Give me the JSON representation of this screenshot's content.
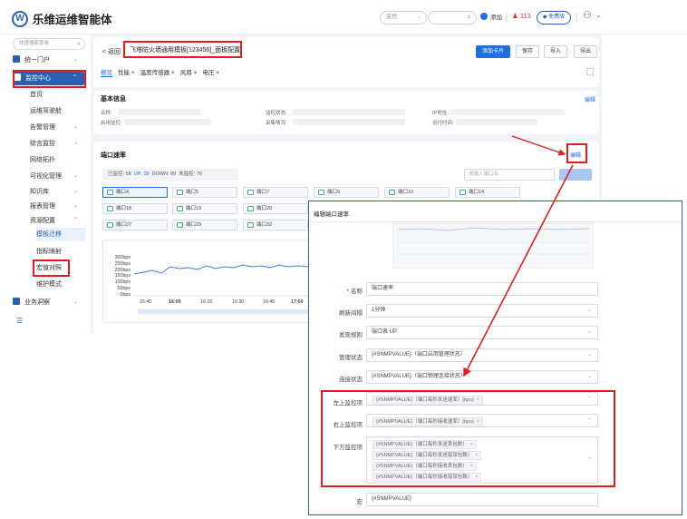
{
  "app": {
    "name": "乐维运维智能体",
    "logo_icon": "lewei-logo-icon"
  },
  "topbar": {
    "monitor_select": "监控",
    "add_label": "添加",
    "alarm_count": "113",
    "free_label": "免费版"
  },
  "sidebar": {
    "search_placeholder": "快速搜索菜单",
    "items": [
      {
        "label": "统一门户"
      },
      {
        "label": "监控中心"
      },
      {
        "label": "首页"
      },
      {
        "label": "运维驾驶舱"
      },
      {
        "label": "告警管理"
      },
      {
        "label": "综合监控"
      },
      {
        "label": "网络拓扑"
      },
      {
        "label": "可视化管理"
      },
      {
        "label": "知识库"
      },
      {
        "label": "报表管理"
      },
      {
        "label": "资源配置"
      },
      {
        "label": "模板迁移"
      },
      {
        "label": "指标映射"
      },
      {
        "label": "宏值对照"
      },
      {
        "label": "维护模式"
      },
      {
        "label": "业务洞察"
      }
    ]
  },
  "page": {
    "back_label": "< 返回",
    "title": "飞塔防火墙通用模板[123456]_面板配置",
    "buttons": {
      "add_card": "添加卡片",
      "save": "保存",
      "import": "导入",
      "export": "导出"
    },
    "tabs": [
      "概览",
      "性能 ×",
      "温度传感器 ×",
      "风扇 ×",
      "电压 ×"
    ]
  },
  "basic_info": {
    "title": "基本信息",
    "edit": "编辑",
    "fields": {
      "name": "名称:",
      "monitor_status": "监控状态:",
      "ip": "IP地址:",
      "enabled_monitor": "启用监控:",
      "collect_status": "采集情况:",
      "uptime": "运行时间:"
    }
  },
  "port_rate": {
    "title": "端口速率",
    "edit": "编辑",
    "stat_prefix": "已监控: 58",
    "stat_up": "UP: 39",
    "stat_down": "DOWN: 89",
    "stat_unmon": "未监控: 70",
    "search_placeholder": "请输入端口名",
    "ports": [
      "端口4",
      "端口5",
      "端口7",
      "端口9",
      "端口10",
      "端口14",
      "端口18",
      "端口19",
      "端口20",
      "端口27",
      "端口29",
      "端口32"
    ],
    "y_ticks": [
      "300bps",
      "250bps",
      "200bps",
      "150bps",
      "100bps",
      "50bps",
      "0bps"
    ],
    "x_ticks": [
      "15:45",
      "16:00",
      "16:15",
      "16:30",
      "16:45",
      "17:00"
    ]
  },
  "modal": {
    "title": "编辑端口速率",
    "fields": {
      "name_label": "名称",
      "name_value": "端口速率",
      "refresh_label": "刷新间隔",
      "refresh_value": "1分钟",
      "discover_label": "发现规则",
      "discover_value": "端口表 UP",
      "admin_label": "管理状态",
      "admin_value": "{#SNMPVALUE}（端口启用管理状态）",
      "link_label": "连接状态",
      "link_value": "{#SNMPVALUE}（端口物理连接状态）",
      "left_label": "左上监控项",
      "left_tag": "{#SNMPVALUE}（端口每秒发送速率）(bps)",
      "right_label": "右上监控项",
      "right_tag": "{#SNMPVALUE}（端口每秒接收速率）(bps)",
      "bottom_label": "下方监控项",
      "bottom_tags": [
        "{#SNMPVALUE}（端口每秒发送丢包数）",
        "{#SNMPVALUE}（端口每秒发送错误包数）",
        "{#SNMPVALUE}（端口每秒接收丢包数）",
        "{#SNMPVALUE}（端口每秒接收错误包数）"
      ],
      "macro_label": "宏",
      "macro_value": "{#SNMPVALUE}"
    }
  },
  "colors": {
    "primary": "#1f6fe0",
    "highlight": "#e11d1d",
    "sidebar_active": "#2a5fb4"
  }
}
